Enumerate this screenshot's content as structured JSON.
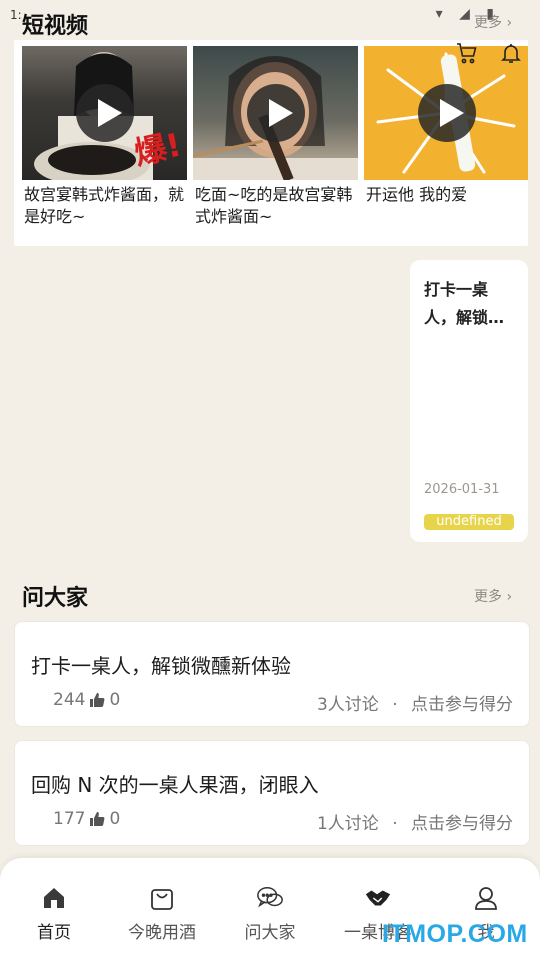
{
  "status": {
    "time": "1:",
    "icons": "▾ ◢ ▮"
  },
  "short_video": {
    "title": "短视频",
    "more": "更多",
    "items": [
      {
        "title": "故宫宴韩式炸酱面，就是好吃~",
        "badge": "爆!"
      },
      {
        "title": "吃面~吃的是故宫宴韩式炸酱面~"
      },
      {
        "title": "开运他 我的爱"
      }
    ]
  },
  "article": {
    "title": "打卡一桌人，解锁…",
    "date": "2026-01-31",
    "tag": "undefined"
  },
  "ask": {
    "title": "问大家",
    "more": "更多",
    "questions": [
      {
        "title": "打卡一桌人，解锁微醺新体验",
        "likes": "244",
        "comments": "0",
        "discuss": "3人讨论",
        "sep": "·",
        "action": "点击参与得分"
      },
      {
        "title": "回购 N 次的一桌人果酒，闭眼入",
        "likes": "177",
        "comments": "0",
        "discuss": "1人讨论",
        "sep": "·",
        "action": "点击参与得分"
      }
    ]
  },
  "nav": [
    {
      "label": "首页",
      "icon": "home-icon"
    },
    {
      "label": "今晚用酒",
      "icon": "shopping-bag-icon"
    },
    {
      "label": "问大家",
      "icon": "chat-bubbles-icon"
    },
    {
      "label": "一桌博客",
      "icon": "handshake-icon"
    },
    {
      "label": "我",
      "icon": "user-icon"
    }
  ],
  "watermark": "ITMOP.COM",
  "colors": {
    "background": "#f3efe6",
    "tag": "#e8d44a",
    "watermark": "#29a8e6"
  }
}
